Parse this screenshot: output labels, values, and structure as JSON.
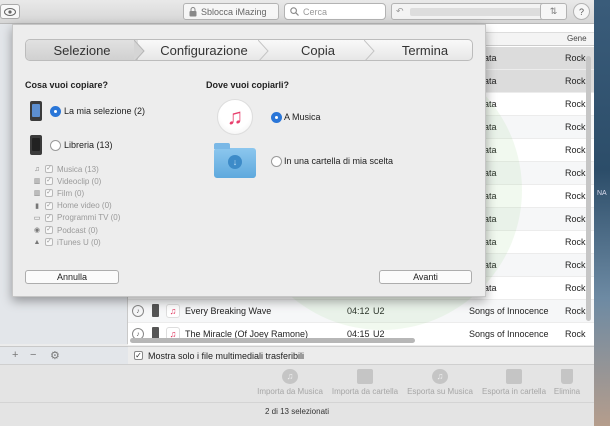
{
  "toolbar": {
    "unlock_label": "Sblocca iMazing",
    "search_placeholder": "Cerca"
  },
  "table": {
    "columns": [
      "n",
      "Gene"
    ],
    "rows": [
      {
        "title": "",
        "time": "",
        "artist": "",
        "album": "pettata",
        "genre": "Rock"
      },
      {
        "title": "",
        "time": "",
        "artist": "",
        "album": "pettata",
        "genre": "Rock"
      },
      {
        "title": "",
        "time": "",
        "artist": "",
        "album": "pettata",
        "genre": "Rock"
      },
      {
        "title": "",
        "time": "",
        "artist": "",
        "album": "pettata",
        "genre": "Rock"
      },
      {
        "title": "",
        "time": "",
        "artist": "",
        "album": "pettata",
        "genre": "Rock"
      },
      {
        "title": "",
        "time": "",
        "artist": "",
        "album": "pettata",
        "genre": "Rock"
      },
      {
        "title": "",
        "time": "",
        "artist": "",
        "album": "pettata",
        "genre": "Rock"
      },
      {
        "title": "",
        "time": "",
        "artist": "",
        "album": "pettata",
        "genre": "Rock"
      },
      {
        "title": "",
        "time": "",
        "artist": "",
        "album": "pettata",
        "genre": "Rock"
      },
      {
        "title": "",
        "time": "",
        "artist": "",
        "album": "pettata",
        "genre": "Rock"
      },
      {
        "title": "",
        "time": "",
        "artist": "",
        "album": "pettata",
        "genre": "Rock"
      },
      {
        "title": "Every Breaking Wave",
        "time": "04:12",
        "artist": "U2",
        "album": "Songs of Innocence",
        "genre": "Rock"
      },
      {
        "title": "The Miracle (Of Joey Ramone)",
        "time": "04:15",
        "artist": "U2",
        "album": "Songs of Innocence",
        "genre": "Rock"
      }
    ]
  },
  "filter": {
    "label": "Mostra solo i file multimediali trasferibili"
  },
  "actions": [
    {
      "label": "Importa da Musica"
    },
    {
      "label": "Importa da cartella"
    },
    {
      "label": "Esporta su Musica"
    },
    {
      "label": "Esporta in cartella"
    },
    {
      "label": "Elimina"
    }
  ],
  "status": "2 di 13 selezionati",
  "wallpaper_text": "NA",
  "dialog": {
    "steps": [
      "Selezione",
      "Configurazione",
      "Copia",
      "Termina"
    ],
    "left_title": "Cosa vuoi copiare?",
    "right_title": "Dove vuoi copiarli?",
    "option_selection": "La mia selezione (2)",
    "option_library": "Libreria (13)",
    "sub_items": [
      {
        "label": "Musica (13)",
        "icon": "music-note-icon"
      },
      {
        "label": "Videoclip (0)",
        "icon": "film-icon"
      },
      {
        "label": "Film (0)",
        "icon": "film-icon"
      },
      {
        "label": "Home video (0)",
        "icon": "video-icon"
      },
      {
        "label": "Programmi TV (0)",
        "icon": "tv-icon"
      },
      {
        "label": "Podcast (0)",
        "icon": "podcast-icon"
      },
      {
        "label": "iTunes U (0)",
        "icon": "graduation-cap-icon"
      }
    ],
    "dest_music": "A Musica",
    "dest_folder": "In una cartella di mia scelta",
    "cancel_label": "Annulla",
    "next_label": "Avanti"
  },
  "colors": {
    "accent": "#2a76d8",
    "music_red": "#e83e6c",
    "folder_blue": "#5ea9dd"
  }
}
